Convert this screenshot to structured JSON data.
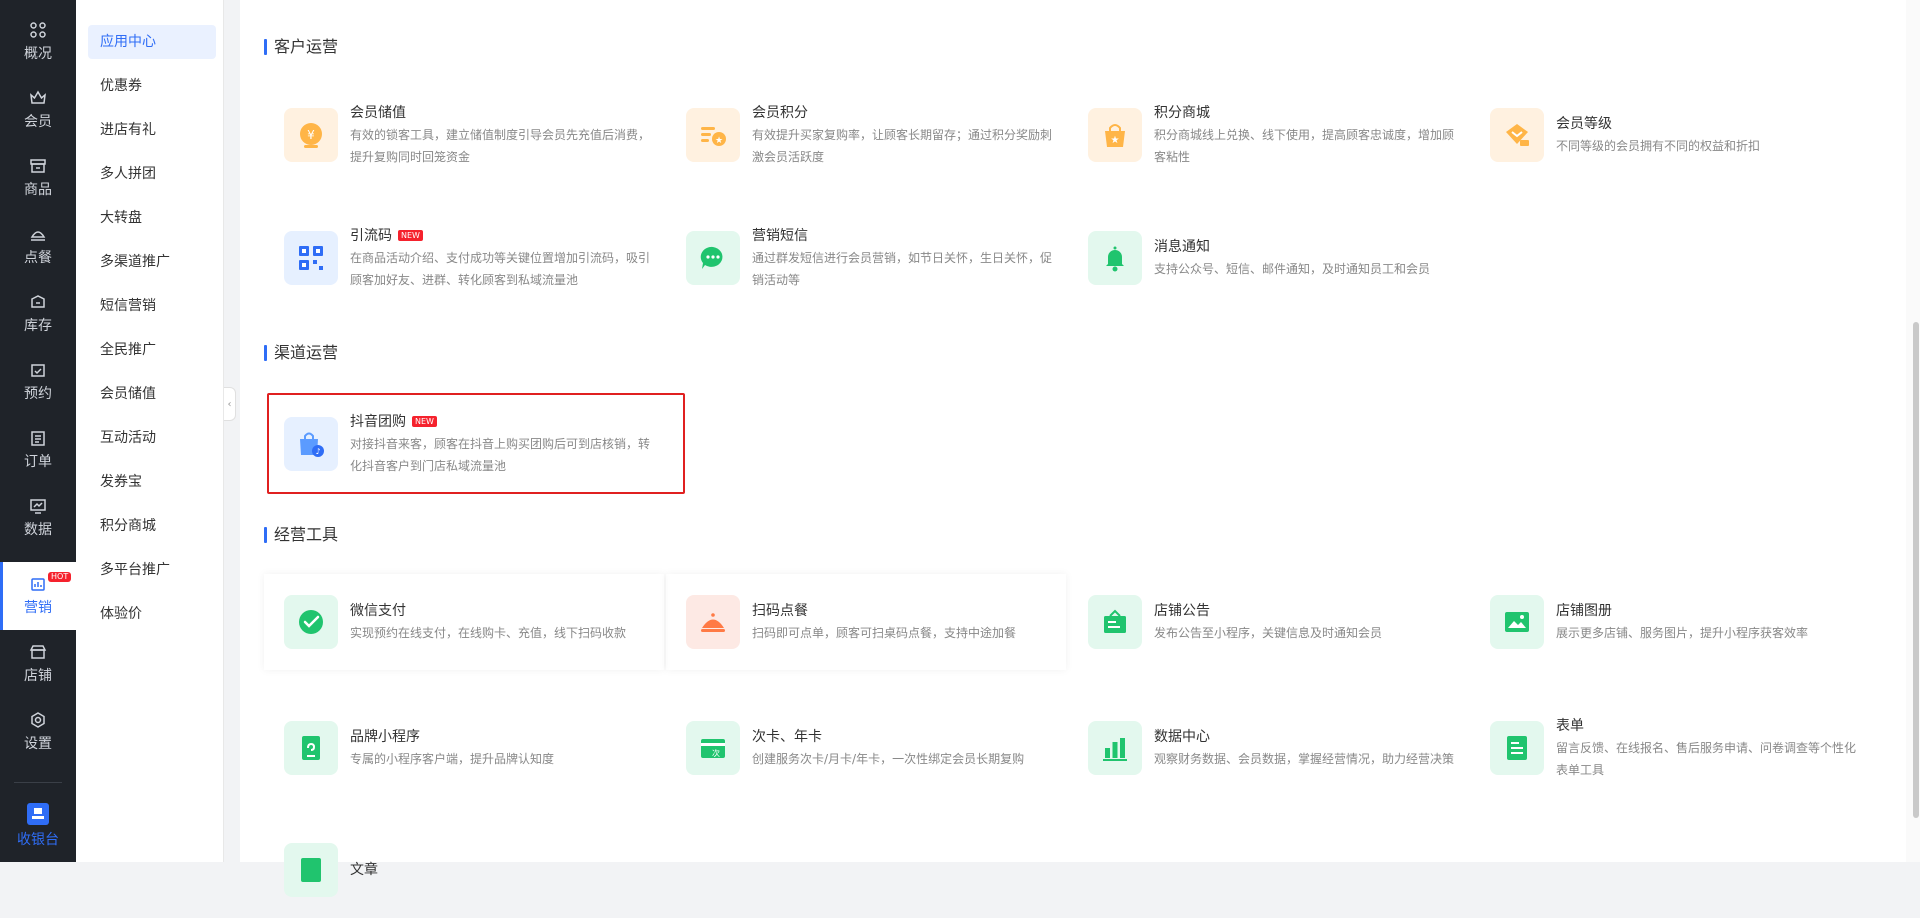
{
  "nav": {
    "items": [
      {
        "label": "概况",
        "icon": "grid-icon"
      },
      {
        "label": "会员",
        "icon": "crown-icon"
      },
      {
        "label": "商品",
        "icon": "shop-icon"
      },
      {
        "label": "点餐",
        "icon": "dish-icon"
      },
      {
        "label": "库存",
        "icon": "box-icon"
      },
      {
        "label": "预约",
        "icon": "calendar-check-icon"
      },
      {
        "label": "订单",
        "icon": "clipboard-icon"
      },
      {
        "label": "数据",
        "icon": "chart-screen-icon"
      },
      {
        "label": "营销",
        "icon": "marketing-icon",
        "badge": "HOT"
      },
      {
        "label": "店铺",
        "icon": "store-icon"
      },
      {
        "label": "设置",
        "icon": "gear-icon"
      }
    ],
    "bottom": {
      "label": "收银台",
      "icon": "cashier-icon"
    },
    "active_color": "#2f6df6"
  },
  "submenu": {
    "items": [
      "应用中心",
      "优惠券",
      "进店有礼",
      "多人拼团",
      "大转盘",
      "多渠道推广",
      "短信营销",
      "全民推广",
      "会员储值",
      "互动活动",
      "发券宝",
      "积分商城",
      "多平台推广",
      "体验价"
    ],
    "active": "应用中心"
  },
  "sections": [
    {
      "title": "客户运营",
      "cards": [
        {
          "name": "会员储值",
          "desc": "有效的锁客工具，建立储值制度引导会员先充值后消费，提升复购同时回笼资金",
          "icon": "yen-coin-icon"
        },
        {
          "name": "会员积分",
          "desc": "有效提升买家复购率，让顾客长期留存；通过积分奖励刺激会员活跃度",
          "icon": "points-list-icon"
        },
        {
          "name": "积分商城",
          "desc": "积分商城线上兑换、线下使用，提高顾客忠诚度，增加顾客粘性",
          "icon": "shopping-bag-star-icon"
        },
        {
          "name": "会员等级",
          "desc": "不同等级的会员拥有不同的权益和折扣",
          "icon": "diamond-tag-icon"
        },
        {
          "name": "引流码",
          "badge": "NEW",
          "desc": "在商品活动介绍、支付成功等关键位置增加引流码，吸引顾客加好友、进群、转化顾客到私域流量池",
          "icon": "qr-code-icon"
        },
        {
          "name": "营销短信",
          "desc": "通过群发短信进行会员营销，如节日关怀，生日关怀，促销活动等",
          "icon": "message-bubble-icon"
        },
        {
          "name": "消息通知",
          "desc": "支持公众号、短信、邮件通知，及时通知员工和会员",
          "icon": "bell-icon"
        }
      ]
    },
    {
      "title": "渠道运营",
      "cards": [
        {
          "name": "抖音团购",
          "badge": "NEW",
          "desc": "对接抖音来客，顾客在抖音上购买团购后可到店核销，转化抖音客户到门店私域流量池",
          "icon": "douyin-bag-icon"
        }
      ]
    },
    {
      "title": "经营工具",
      "cards": [
        {
          "name": "微信支付",
          "desc": "实现预约在线支付，在线购卡、充值，线下扫码收款",
          "icon": "wechat-pay-icon"
        },
        {
          "name": "扫码点餐",
          "desc": "扫码即可点单，顾客可扫桌码点餐，支持中途加餐",
          "icon": "cloche-icon"
        },
        {
          "name": "店铺公告",
          "desc": "发布公告至小程序，关键信息及时通知会员",
          "icon": "announcement-icon"
        },
        {
          "name": "店铺图册",
          "desc": "展示更多店铺、服务图片，提升小程序获客效率",
          "icon": "image-icon"
        },
        {
          "name": "品牌小程序",
          "desc": "专属的小程序客户端，提升品牌认知度",
          "icon": "mini-program-icon"
        },
        {
          "name": "次卡、年卡",
          "desc": "创建服务次卡/月卡/年卡，一次性绑定会员长期复购",
          "icon": "card-ci-icon"
        },
        {
          "name": "数据中心",
          "desc": "观察财务数据、会员数据，掌握经营情况，助力经营决策",
          "icon": "bar-chart-icon"
        },
        {
          "name": "表单",
          "desc": "留言反馈、在线报名、售后服务申请、问卷调查等个性化表单工具",
          "icon": "form-icon"
        },
        {
          "name": "文章",
          "desc": "",
          "icon": "article-icon"
        }
      ]
    }
  ]
}
